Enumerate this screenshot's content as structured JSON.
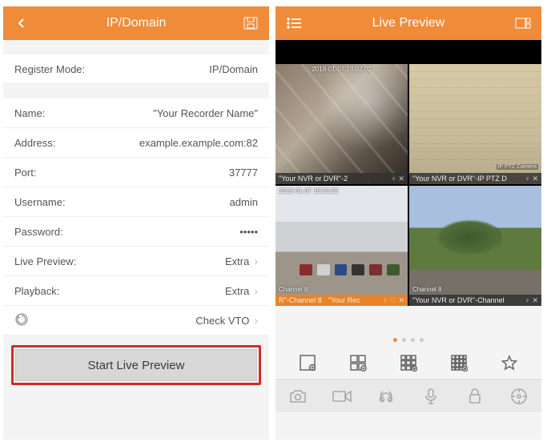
{
  "left": {
    "header": {
      "title": "IP/Domain"
    },
    "register_mode": {
      "label": "Register Mode:",
      "value": "IP/Domain"
    },
    "fields": {
      "name": {
        "label": "Name:",
        "value": "\"Your Recorder Name\""
      },
      "address": {
        "label": "Address:",
        "value": "example.example.com:82"
      },
      "port": {
        "label": "Port:",
        "value": "37777"
      },
      "username": {
        "label": "Username:",
        "value": "admin"
      },
      "password": {
        "label": "Password:",
        "value": "•••••"
      },
      "live": {
        "label": "Live Preview:",
        "value": "Extra"
      },
      "playback": {
        "label": "Playback:",
        "value": "Extra"
      },
      "vto": {
        "label": "Check VTO"
      }
    },
    "start_button": "Start Live Preview"
  },
  "right": {
    "header": {
      "title": "Live Preview"
    },
    "cameras": [
      {
        "caption": "\"Your NVR or DVR\"-2",
        "timestamp": "2018-01-07 18:02:02",
        "selected": false
      },
      {
        "caption": "\"Your NVR or DVR\"-IP PTZ D",
        "ptz": "IP PTZ Camera",
        "selected": false
      },
      {
        "caption": "R\"-Channel 8",
        "sub": "\"Your Rec",
        "channel": "Channel 8",
        "timestamp": "2018-01-07 18:02:02",
        "selected": true
      },
      {
        "caption": "\"Your NVR or DVR\"-Channel",
        "channel": "Channel 8",
        "selected": false
      }
    ],
    "page_dots": {
      "count": 4,
      "active": 0
    }
  }
}
